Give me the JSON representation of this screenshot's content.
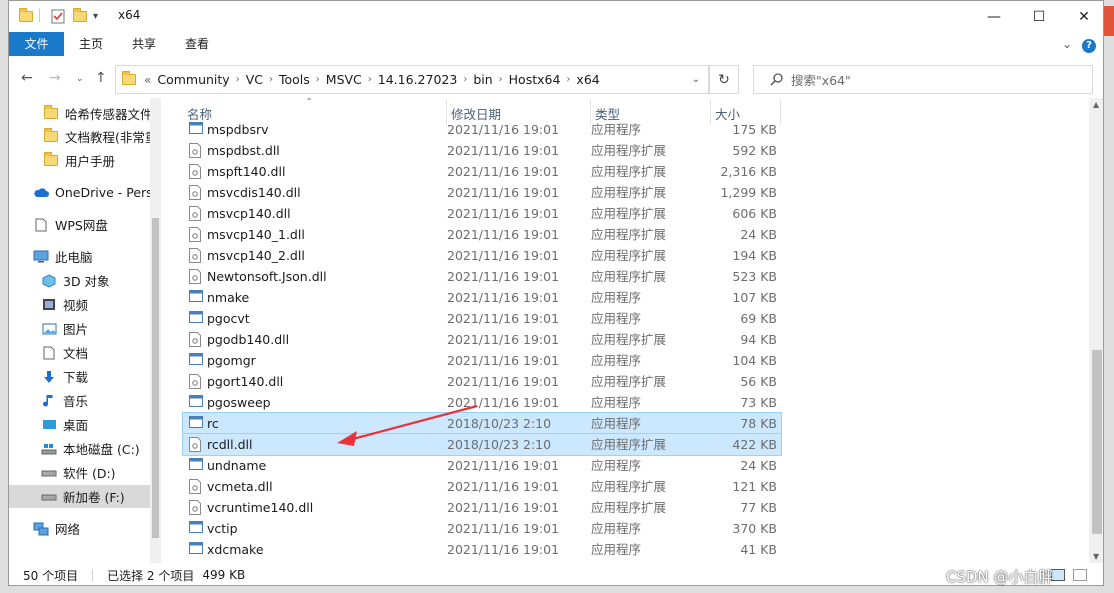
{
  "window": {
    "title": "x64",
    "minimize": "—",
    "maximize": "☐",
    "close": "✕"
  },
  "ribbon": {
    "tabs": [
      "文件",
      "主页",
      "共享",
      "查看"
    ],
    "expand": "⌄",
    "help": "?"
  },
  "address": {
    "overflow": "«",
    "crumbs": [
      "Community",
      "VC",
      "Tools",
      "MSVC",
      "14.16.27023",
      "bin",
      "Hostx64",
      "x64"
    ],
    "dropdown": "⌄",
    "search_placeholder": "搜索\"x64\""
  },
  "nav": {
    "items": [
      {
        "label": "哈希传感器文件",
        "icon": "folder-icon"
      },
      {
        "label": "文档教程(非常重",
        "icon": "folder-icon"
      },
      {
        "label": "用户手册",
        "icon": "folder-icon"
      },
      {
        "label": "OneDrive - Perso",
        "icon": "cloud-icon"
      },
      {
        "label": "WPS网盘",
        "icon": "document-icon"
      },
      {
        "label": "此电脑",
        "icon": "computer-icon"
      },
      {
        "label": "3D 对象",
        "icon": "cube-icon"
      },
      {
        "label": "视频",
        "icon": "film-icon"
      },
      {
        "label": "图片",
        "icon": "picture-icon"
      },
      {
        "label": "文档",
        "icon": "document-icon"
      },
      {
        "label": "下载",
        "icon": "download-arrow-icon"
      },
      {
        "label": "音乐",
        "icon": "music-note-icon"
      },
      {
        "label": "桌面",
        "icon": "desktop-icon"
      },
      {
        "label": "本地磁盘 (C:)",
        "icon": "windows-drive-icon"
      },
      {
        "label": "软件 (D:)",
        "icon": "drive-icon"
      },
      {
        "label": "新加卷 (F:)",
        "icon": "drive-icon"
      },
      {
        "label": "网络",
        "icon": "network-icon"
      }
    ]
  },
  "columns": {
    "name": "名称",
    "date": "修改日期",
    "type": "类型",
    "size": "大小"
  },
  "files": [
    {
      "name": "mspdbsrv",
      "date": "2021/11/16 19:01",
      "type": "应用程序",
      "size": "175 KB",
      "kind": "exe",
      "selected": false
    },
    {
      "name": "mspdbst.dll",
      "date": "2021/11/16 19:01",
      "type": "应用程序扩展",
      "size": "592 KB",
      "kind": "dll",
      "selected": false
    },
    {
      "name": "mspft140.dll",
      "date": "2021/11/16 19:01",
      "type": "应用程序扩展",
      "size": "2,316 KB",
      "kind": "dll",
      "selected": false
    },
    {
      "name": "msvcdis140.dll",
      "date": "2021/11/16 19:01",
      "type": "应用程序扩展",
      "size": "1,299 KB",
      "kind": "dll",
      "selected": false
    },
    {
      "name": "msvcp140.dll",
      "date": "2021/11/16 19:01",
      "type": "应用程序扩展",
      "size": "606 KB",
      "kind": "dll",
      "selected": false
    },
    {
      "name": "msvcp140_1.dll",
      "date": "2021/11/16 19:01",
      "type": "应用程序扩展",
      "size": "24 KB",
      "kind": "dll",
      "selected": false
    },
    {
      "name": "msvcp140_2.dll",
      "date": "2021/11/16 19:01",
      "type": "应用程序扩展",
      "size": "194 KB",
      "kind": "dll",
      "selected": false
    },
    {
      "name": "Newtonsoft.Json.dll",
      "date": "2021/11/16 19:01",
      "type": "应用程序扩展",
      "size": "523 KB",
      "kind": "dll",
      "selected": false
    },
    {
      "name": "nmake",
      "date": "2021/11/16 19:01",
      "type": "应用程序",
      "size": "107 KB",
      "kind": "exe",
      "selected": false
    },
    {
      "name": "pgocvt",
      "date": "2021/11/16 19:01",
      "type": "应用程序",
      "size": "69 KB",
      "kind": "exe",
      "selected": false
    },
    {
      "name": "pgodb140.dll",
      "date": "2021/11/16 19:01",
      "type": "应用程序扩展",
      "size": "94 KB",
      "kind": "dll",
      "selected": false
    },
    {
      "name": "pgomgr",
      "date": "2021/11/16 19:01",
      "type": "应用程序",
      "size": "104 KB",
      "kind": "exe",
      "selected": false
    },
    {
      "name": "pgort140.dll",
      "date": "2021/11/16 19:01",
      "type": "应用程序扩展",
      "size": "56 KB",
      "kind": "dll",
      "selected": false
    },
    {
      "name": "pgosweep",
      "date": "2021/11/16 19:01",
      "type": "应用程序",
      "size": "73 KB",
      "kind": "exe",
      "selected": false
    },
    {
      "name": "rc",
      "date": "2018/10/23 2:10",
      "type": "应用程序",
      "size": "78 KB",
      "kind": "exe",
      "selected": true
    },
    {
      "name": "rcdll.dll",
      "date": "2018/10/23 2:10",
      "type": "应用程序扩展",
      "size": "422 KB",
      "kind": "dll",
      "selected": true
    },
    {
      "name": "undname",
      "date": "2021/11/16 19:01",
      "type": "应用程序",
      "size": "24 KB",
      "kind": "exe",
      "selected": false
    },
    {
      "name": "vcmeta.dll",
      "date": "2021/11/16 19:01",
      "type": "应用程序扩展",
      "size": "121 KB",
      "kind": "dll",
      "selected": false
    },
    {
      "name": "vcruntime140.dll",
      "date": "2021/11/16 19:01",
      "type": "应用程序扩展",
      "size": "77 KB",
      "kind": "dll",
      "selected": false
    },
    {
      "name": "vctip",
      "date": "2021/11/16 19:01",
      "type": "应用程序",
      "size": "370 KB",
      "kind": "exe",
      "selected": false
    },
    {
      "name": "xdcmake",
      "date": "2021/11/16 19:01",
      "type": "应用程序",
      "size": "41 KB",
      "kind": "exe",
      "selected": false
    }
  ],
  "status": {
    "count": "50 个项目",
    "selection": "已选择 2 个项目",
    "size": "499 KB"
  },
  "watermark": "CSDN @小白胖",
  "colors": {
    "accent": "#1979ca",
    "selection": "#cce8ff",
    "annotation_arrow": "#e8333a"
  }
}
